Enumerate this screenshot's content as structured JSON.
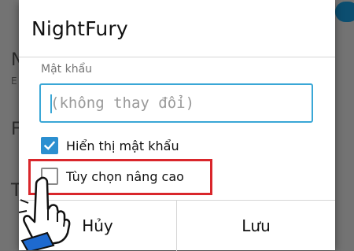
{
  "background": {
    "letters": [
      "N",
      "F",
      "T"
    ],
    "sub_text": "E"
  },
  "dialog": {
    "title": "NightFury",
    "password": {
      "label": "Mật khẩu",
      "placeholder": "(không thay đổi)",
      "value": ""
    },
    "show_password": {
      "label": "Hiển thị mật khẩu",
      "checked": true
    },
    "advanced_options": {
      "label": "Tùy chọn nâng cao",
      "checked": false
    },
    "buttons": {
      "cancel": "Hủy",
      "save": "Lưu"
    }
  },
  "colors": {
    "accent": "#2b8fd0",
    "input_border": "#3aa7d6",
    "highlight": "#d9262b",
    "overlay": "#737373"
  },
  "icons": {
    "pointer": "hand-pointer-icon",
    "check": "checkmark-icon"
  }
}
